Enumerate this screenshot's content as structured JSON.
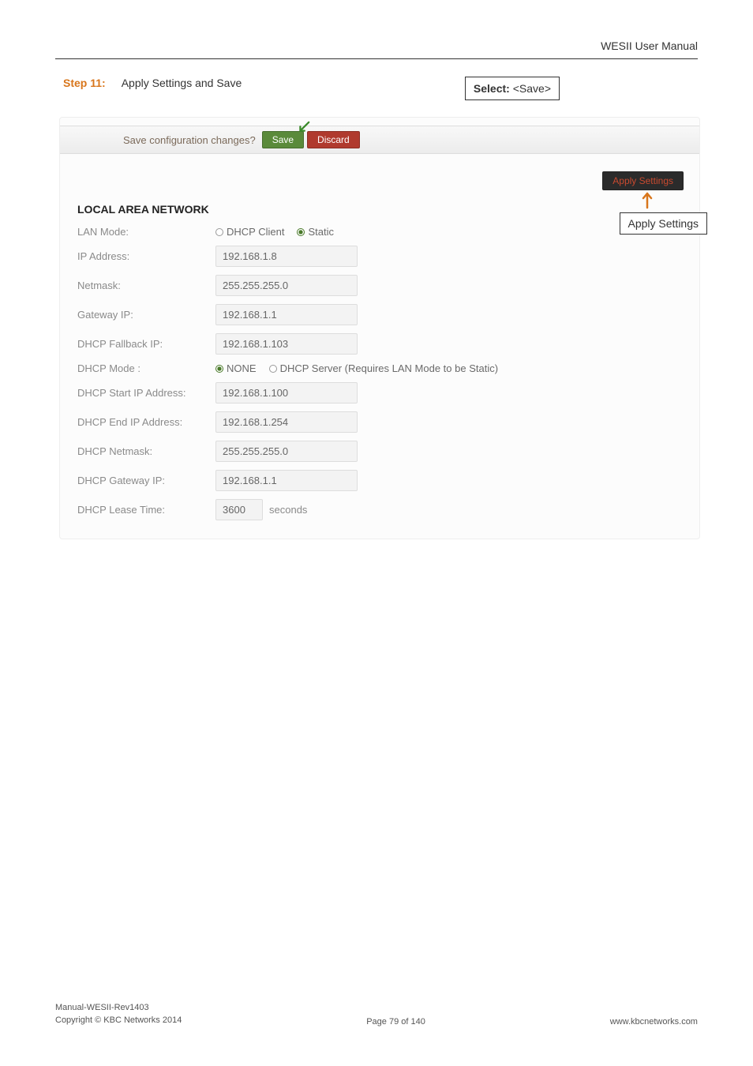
{
  "header": {
    "manual_title": "WESII User Manual"
  },
  "step": {
    "label": "Step 11:",
    "title": "Apply Settings and Save",
    "select_label": "Select:",
    "select_value": "<Save>"
  },
  "save_bar": {
    "label": "Save configuration changes?",
    "save_btn": "Save",
    "discard_btn": "Discard"
  },
  "apply": {
    "button_label": "Apply Settings",
    "callout_label": "Apply Settings"
  },
  "section": {
    "heading": "LOCAL AREA NETWORK"
  },
  "fields": {
    "lan_mode_label": "LAN Mode:",
    "lan_mode_dhcp": "DHCP Client",
    "lan_mode_static": "Static",
    "ip_address_label": "IP Address:",
    "ip_address_value": "192.168.1.8",
    "netmask_label": "Netmask:",
    "netmask_value": "255.255.255.0",
    "gateway_label": "Gateway IP:",
    "gateway_value": "192.168.1.1",
    "fallback_label": "DHCP Fallback IP:",
    "fallback_value": "192.168.1.103",
    "dhcp_mode_label": "DHCP Mode :",
    "dhcp_mode_none": "NONE",
    "dhcp_mode_server": "DHCP Server (Requires LAN Mode to be Static)",
    "dhcp_start_label": "DHCP Start IP Address:",
    "dhcp_start_value": "192.168.1.100",
    "dhcp_end_label": "DHCP End IP Address:",
    "dhcp_end_value": "192.168.1.254",
    "dhcp_netmask_label": "DHCP Netmask:",
    "dhcp_netmask_value": "255.255.255.0",
    "dhcp_gateway_label": "DHCP Gateway IP:",
    "dhcp_gateway_value": "192.168.1.1",
    "dhcp_lease_label": "DHCP Lease Time:",
    "dhcp_lease_value": "3600",
    "dhcp_lease_unit": "seconds"
  },
  "footer": {
    "line1": "Manual-WESII-Rev1403",
    "line2": "Copyright © KBC Networks 2014",
    "page": "Page 79 of 140",
    "url": "www.kbcnetworks.com"
  }
}
